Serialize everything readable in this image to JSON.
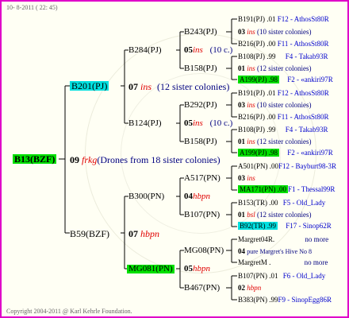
{
  "header": {
    "date": "10- 8-2011 ( 22: 45)"
  },
  "footer": {
    "copyright": "Copyright 2004-2011 @ Karl Kehrle Foundation."
  },
  "root": {
    "name": "B13(BZF)"
  },
  "gen1": {
    "top": {
      "name": "B201(PJ)"
    },
    "top_line": {
      "num": "07",
      "code": "ins",
      "note": "(12 sister colonies)"
    },
    "mid_line": {
      "num": "09",
      "code": "frkg",
      "note": "(Drones from 18 sister colonies)"
    },
    "bottom": {
      "name": "B59(BZF)"
    },
    "bottom_line": {
      "num": "07",
      "code": "hbpn"
    }
  },
  "gen2": {
    "b284": {
      "name": "B284(PJ)"
    },
    "b284_line": {
      "num": "05",
      "code": "ins",
      "note": "(10 c.)"
    },
    "b124": {
      "name": "B124(PJ)"
    },
    "b124_line": {
      "num": "05",
      "code": "ins",
      "note": "(10 c.)"
    },
    "b300": {
      "name": "B300(PN)"
    },
    "b300_line": {
      "num": "04",
      "code": "hbpn"
    },
    "mg081": {
      "name": "MG081(PN)"
    },
    "mg081_line": {
      "num": "05",
      "code": "hbpn"
    }
  },
  "gen3": {
    "b243": {
      "name": "B243(PJ)"
    },
    "b158a": {
      "name": "B158(PJ)"
    },
    "b292": {
      "name": "B292(PJ)"
    },
    "b158b": {
      "name": "B158(PJ)"
    },
    "a517": {
      "name": "A517(PN)"
    },
    "b107a": {
      "name": "B107(PN)"
    },
    "mg08": {
      "name": "MG08(PN)"
    },
    "b467": {
      "name": "B467(PN)"
    }
  },
  "gen4": [
    {
      "name": "B191(PJ)",
      "num": ".01",
      "detail": "F12 - AthosSt80R"
    },
    {
      "num": "03",
      "code": "ins",
      "detail": "(10 sister colonies)"
    },
    {
      "name": "B216(PJ)",
      "num": ".00",
      "detail": "F11 - AthosSt80R"
    },
    {
      "name": "B108(PJ)",
      "num": ".99",
      "detail": "F4 - Takab93R"
    },
    {
      "num": "01",
      "code": "ins",
      "detail": "(12 sister colonies)"
    },
    {
      "name": "A199(PJ)",
      "num": ".98",
      "detail": "F2 - «ankiri97R"
    },
    {
      "name": "B191(PJ)",
      "num": ".01",
      "detail": "F12 - AthosSt80R"
    },
    {
      "num": "03",
      "code": "ins",
      "detail": "(10 sister colonies)"
    },
    {
      "name": "B216(PJ)",
      "num": ".00",
      "detail": "F11 - AthosSt80R"
    },
    {
      "name": "B108(PJ)",
      "num": ".99",
      "detail": "F4 - Takab93R"
    },
    {
      "num": "01",
      "code": "ins",
      "detail": "(12 sister colonies)"
    },
    {
      "name": "A199(PJ)",
      "num": ".98",
      "detail": "F2 - «ankiri97R"
    },
    {
      "name": "A501(PN)",
      "num": ".00",
      "detail": "F12 - Bayburt98-3R"
    },
    {
      "num": "03",
      "code": "ins",
      "detail": ""
    },
    {
      "name": "MA171(PN)",
      "num": ".00",
      "detail": "F1 - Thessal99R"
    },
    {
      "name": "B153(TR)",
      "num": ".00",
      "detail": "F5 - Old_Lady"
    },
    {
      "num": "01",
      "code": "bsl",
      "detail": "(12 sister colonies)"
    },
    {
      "name": "B92(TR)",
      "num": ".99",
      "detail": "F17 - Sinop62R"
    },
    {
      "name": "Margret04R",
      "num": ".",
      "detail": "no more"
    },
    {
      "num": "04",
      "code": "",
      "detail": "pure Margret's Hive No 8"
    },
    {
      "name": "MargretM",
      "num": ".",
      "detail": "no more"
    },
    {
      "name": "B107(PN)",
      "num": ".01",
      "detail": "F6 - Old_Lady"
    },
    {
      "num": "02",
      "code": "hbpn",
      "detail": ""
    },
    {
      "name": "B383(PN)",
      "num": ".99",
      "detail": "F9 - SinopEgg86R"
    }
  ]
}
